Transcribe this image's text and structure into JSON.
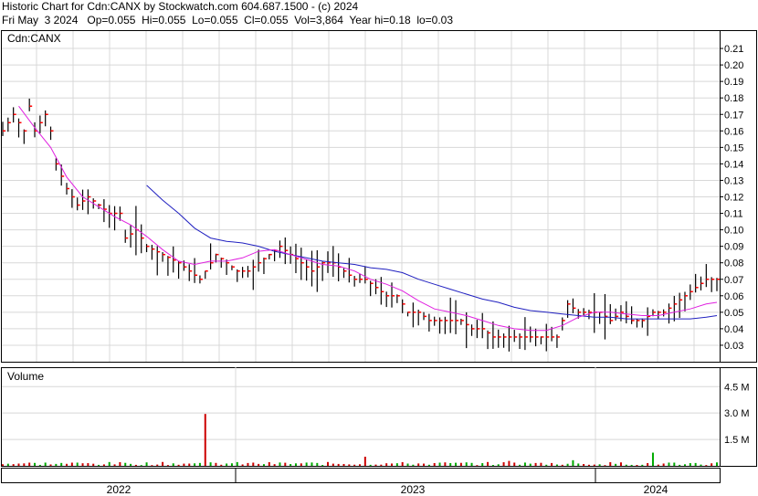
{
  "header": {
    "line1": "Historic Chart for Cdn:CANX by Stockwatch.com 604.687.1500 - (c) 2024",
    "line2": "Fri May  3 2024   Op=0.055  Hi=0.055  Lo=0.055  Cl=0.055  Vol=3,864  Year hi=0.18  lo=0.03"
  },
  "colors": {
    "price_bar": "#000000",
    "close_tick": "#ff0000",
    "ma_short": "#e020e0",
    "ma_long": "#2020c0",
    "volume_up": "#00aa00",
    "volume_down": "#cc0000",
    "grid": "#d8d8d8"
  },
  "chart_data": [
    {
      "type": "ohlc",
      "title": "Cdn:CANX",
      "ylim": [
        0.02,
        0.22
      ],
      "y_ticks": [
        "0.21",
        "0.20",
        "0.19",
        "0.18",
        "0.17",
        "0.16",
        "0.15",
        "0.14",
        "0.13",
        "0.12",
        "0.11",
        "0.10",
        "0.09",
        "0.08",
        "0.07",
        "0.06",
        "0.05",
        "0.04",
        "0.03"
      ],
      "x_labels": [
        "2022",
        "2023",
        "2024"
      ],
      "price_anchors": [
        [
          0,
          0.16
        ],
        [
          2,
          0.17
        ],
        [
          4,
          0.16
        ],
        [
          5,
          0.175
        ],
        [
          6,
          0.16
        ],
        [
          8,
          0.17
        ],
        [
          9,
          0.16
        ],
        [
          10,
          0.14
        ],
        [
          12,
          0.125
        ],
        [
          14,
          0.115
        ],
        [
          16,
          0.12
        ],
        [
          18,
          0.115
        ],
        [
          20,
          0.11
        ],
        [
          22,
          0.11
        ],
        [
          23,
          0.095
        ],
        [
          25,
          0.1
        ],
        [
          27,
          0.09
        ],
        [
          30,
          0.085
        ],
        [
          33,
          0.08
        ],
        [
          35,
          0.075
        ],
        [
          37,
          0.07
        ],
        [
          39,
          0.08
        ],
        [
          40,
          0.085
        ],
        [
          42,
          0.08
        ],
        [
          44,
          0.075
        ],
        [
          46,
          0.075
        ],
        [
          48,
          0.08
        ],
        [
          50,
          0.085
        ],
        [
          52,
          0.09
        ],
        [
          54,
          0.085
        ],
        [
          56,
          0.08
        ],
        [
          58,
          0.075
        ],
        [
          60,
          0.08
        ],
        [
          62,
          0.08
        ],
        [
          64,
          0.075
        ],
        [
          66,
          0.07
        ],
        [
          68,
          0.07
        ],
        [
          70,
          0.065
        ],
        [
          72,
          0.06
        ],
        [
          74,
          0.06
        ],
        [
          76,
          0.05
        ],
        [
          78,
          0.05
        ],
        [
          80,
          0.045
        ],
        [
          82,
          0.045
        ],
        [
          84,
          0.045
        ],
        [
          86,
          0.045
        ],
        [
          88,
          0.04
        ],
        [
          90,
          0.04
        ],
        [
          92,
          0.035
        ],
        [
          94,
          0.035
        ],
        [
          96,
          0.035
        ],
        [
          98,
          0.035
        ],
        [
          100,
          0.035
        ],
        [
          102,
          0.035
        ],
        [
          104,
          0.035
        ],
        [
          106,
          0.055
        ],
        [
          108,
          0.05
        ],
        [
          110,
          0.05
        ],
        [
          112,
          0.05
        ],
        [
          114,
          0.045
        ],
        [
          116,
          0.05
        ],
        [
          118,
          0.045
        ],
        [
          120,
          0.045
        ],
        [
          122,
          0.05
        ],
        [
          124,
          0.05
        ],
        [
          126,
          0.055
        ],
        [
          128,
          0.06
        ],
        [
          130,
          0.065
        ],
        [
          132,
          0.07
        ],
        [
          134,
          0.07
        ]
      ],
      "ma_short": [
        [
          3,
          0.175
        ],
        [
          6,
          0.162
        ],
        [
          9,
          0.15
        ],
        [
          12,
          0.132
        ],
        [
          15,
          0.12
        ],
        [
          18,
          0.114
        ],
        [
          21,
          0.108
        ],
        [
          24,
          0.103
        ],
        [
          27,
          0.096
        ],
        [
          30,
          0.088
        ],
        [
          33,
          0.081
        ],
        [
          36,
          0.079
        ],
        [
          39,
          0.081
        ],
        [
          42,
          0.081
        ],
        [
          45,
          0.083
        ],
        [
          48,
          0.087
        ],
        [
          51,
          0.088
        ],
        [
          54,
          0.085
        ],
        [
          57,
          0.082
        ],
        [
          60,
          0.079
        ],
        [
          63,
          0.078
        ],
        [
          66,
          0.075
        ],
        [
          69,
          0.07
        ],
        [
          72,
          0.067
        ],
        [
          75,
          0.063
        ],
        [
          78,
          0.057
        ],
        [
          81,
          0.052
        ],
        [
          84,
          0.05
        ],
        [
          87,
          0.048
        ],
        [
          90,
          0.045
        ],
        [
          93,
          0.042
        ],
        [
          96,
          0.04
        ],
        [
          99,
          0.039
        ],
        [
          102,
          0.039
        ],
        [
          105,
          0.042
        ],
        [
          108,
          0.047
        ],
        [
          111,
          0.05
        ],
        [
          114,
          0.05
        ],
        [
          117,
          0.049
        ],
        [
          120,
          0.048
        ],
        [
          123,
          0.048
        ],
        [
          126,
          0.05
        ],
        [
          129,
          0.052
        ],
        [
          132,
          0.055
        ],
        [
          134,
          0.056
        ]
      ],
      "ma_long": [
        [
          27,
          0.127
        ],
        [
          30,
          0.118
        ],
        [
          33,
          0.11
        ],
        [
          36,
          0.101
        ],
        [
          39,
          0.095
        ],
        [
          42,
          0.093
        ],
        [
          45,
          0.092
        ],
        [
          48,
          0.09
        ],
        [
          51,
          0.087
        ],
        [
          54,
          0.085
        ],
        [
          57,
          0.083
        ],
        [
          60,
          0.081
        ],
        [
          63,
          0.08
        ],
        [
          66,
          0.079
        ],
        [
          69,
          0.077
        ],
        [
          72,
          0.076
        ],
        [
          75,
          0.074
        ],
        [
          78,
          0.07
        ],
        [
          81,
          0.067
        ],
        [
          84,
          0.064
        ],
        [
          87,
          0.061
        ],
        [
          90,
          0.058
        ],
        [
          93,
          0.056
        ],
        [
          96,
          0.053
        ],
        [
          99,
          0.051
        ],
        [
          102,
          0.05
        ],
        [
          105,
          0.049
        ],
        [
          108,
          0.048
        ],
        [
          111,
          0.047
        ],
        [
          114,
          0.047
        ],
        [
          117,
          0.046
        ],
        [
          120,
          0.046
        ],
        [
          123,
          0.046
        ],
        [
          126,
          0.046
        ],
        [
          129,
          0.046
        ],
        [
          132,
          0.047
        ],
        [
          134,
          0.048
        ]
      ]
    },
    {
      "type": "bar",
      "title": "Volume",
      "ylim": [
        0,
        5500000
      ],
      "y_ticks": [
        {
          "label": "4.5 M",
          "value": 4500000
        },
        {
          "label": "3.0 M",
          "value": 3000000
        },
        {
          "label": "1.5 M",
          "value": 1500000
        }
      ],
      "spikes": [
        [
          38,
          2950000
        ],
        [
          68,
          520000
        ],
        [
          122,
          750000
        ],
        [
          107,
          320000
        ],
        [
          95,
          280000
        ]
      ]
    }
  ]
}
